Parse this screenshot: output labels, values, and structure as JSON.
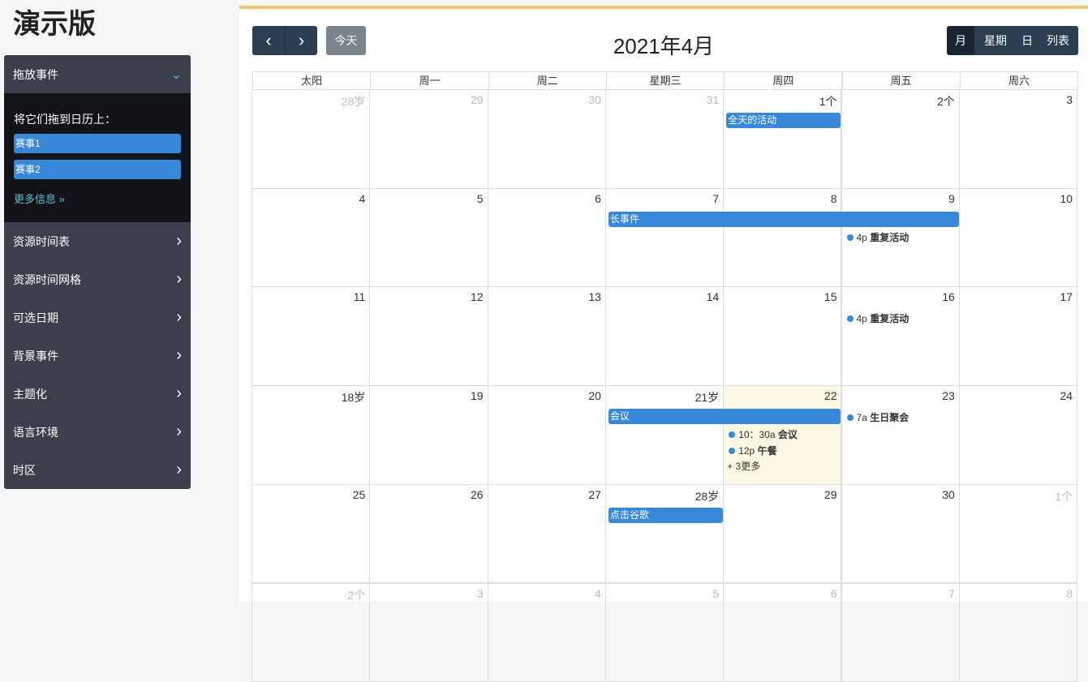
{
  "title": "演示版",
  "sidebar": {
    "open": {
      "label": "拖放事件",
      "instr": "将它们拖到日历上：",
      "events": [
        "赛事1",
        "赛事2"
      ],
      "more": "更多信息 »"
    },
    "items": [
      "资源时间表",
      "资源时间网格",
      "可选日期",
      "背景事件",
      "主题化",
      "语言环境",
      "时区"
    ]
  },
  "toolbar": {
    "prev": "‹",
    "next": "›",
    "today": "今天",
    "title": "2021年4月",
    "views": [
      "月",
      "星期",
      "日",
      "列表"
    ],
    "active_view": "月"
  },
  "colors": {
    "event": "#3788d8",
    "today_bg": "#fcf8e3",
    "accent": "#f1c56b"
  },
  "headers": [
    "太阳",
    "周一",
    "周二",
    "星期三",
    "周四",
    "周五",
    "周六"
  ],
  "weeks": [
    [
      [
        "28岁",
        1
      ],
      [
        "29",
        1
      ],
      [
        "30",
        1
      ],
      [
        "31",
        1
      ],
      [
        "1个",
        0
      ],
      [
        "2个",
        0
      ],
      [
        "3",
        0
      ]
    ],
    [
      [
        "4",
        0
      ],
      [
        "5",
        0
      ],
      [
        "6",
        0
      ],
      [
        "7",
        0
      ],
      [
        "8",
        0
      ],
      [
        "9",
        0
      ],
      [
        "10",
        0
      ]
    ],
    [
      [
        "11",
        0
      ],
      [
        "12",
        0
      ],
      [
        "13",
        0
      ],
      [
        "14",
        0
      ],
      [
        "15",
        0
      ],
      [
        "16",
        0
      ],
      [
        "17",
        0
      ]
    ],
    [
      [
        "18岁",
        0
      ],
      [
        "19",
        0
      ],
      [
        "20",
        0
      ],
      [
        "21岁",
        0
      ],
      [
        "22",
        0
      ],
      [
        "23",
        0
      ],
      [
        "24",
        0
      ]
    ],
    [
      [
        "25",
        0
      ],
      [
        "26",
        0
      ],
      [
        "27",
        0
      ],
      [
        "28岁",
        0
      ],
      [
        "29",
        0
      ],
      [
        "30",
        0
      ],
      [
        "1个",
        1
      ]
    ],
    [
      [
        "2个",
        1
      ],
      [
        "3",
        1
      ],
      [
        "4",
        1
      ],
      [
        "5",
        1
      ],
      [
        "6",
        1
      ],
      [
        "7",
        1
      ],
      [
        "8",
        1
      ]
    ]
  ],
  "today": {
    "week": 3,
    "day": 4
  },
  "bars": [
    {
      "week": 0,
      "day": 4,
      "span": 1,
      "label": "全天的活动"
    },
    {
      "week": 1,
      "day": 3,
      "span": 3,
      "label": "长事件"
    },
    {
      "week": 3,
      "day": 3,
      "span": 2,
      "label": "会议"
    },
    {
      "week": 4,
      "day": 3,
      "span": 1,
      "label": "点击谷歌"
    }
  ],
  "dots": [
    {
      "week": 1,
      "day": 5,
      "slot": 0,
      "time": "4p",
      "label": "重复活动"
    },
    {
      "week": 2,
      "day": 5,
      "slot": -1,
      "time": "4p",
      "label": "重复活动"
    },
    {
      "week": 3,
      "day": 5,
      "slot": -1,
      "time": "7a",
      "label": "生日聚会"
    },
    {
      "week": 3,
      "day": 4,
      "slot": 0,
      "time": "10：30a",
      "label": "会议"
    },
    {
      "week": 3,
      "day": 4,
      "slot": 1,
      "time": "12p",
      "label": "午餐"
    }
  ],
  "more_links": [
    {
      "week": 3,
      "day": 4,
      "label": "+ 3更多"
    }
  ]
}
